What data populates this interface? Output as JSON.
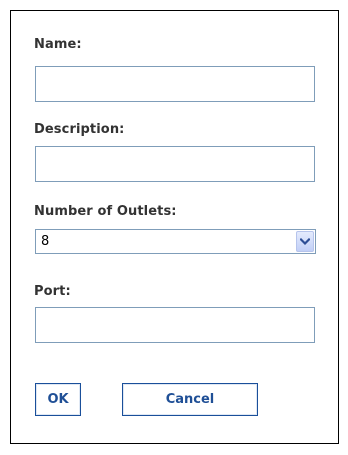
{
  "form": {
    "name_label": "Name:",
    "name_value": "",
    "description_label": "Description:",
    "description_value": "",
    "outlets_label": "Number of Outlets:",
    "outlets_value": "8",
    "port_label": "Port:",
    "port_value": ""
  },
  "buttons": {
    "ok_label": "OK",
    "cancel_label": "Cancel"
  },
  "icons": {
    "select_arrow": "chevron-down-icon"
  },
  "colors": {
    "label_text": "#333333",
    "input_border": "#7f9db9",
    "button_text": "#1f4f96",
    "button_border": "#1a4f9a",
    "dropdown_arrow": "#2c4d95"
  }
}
